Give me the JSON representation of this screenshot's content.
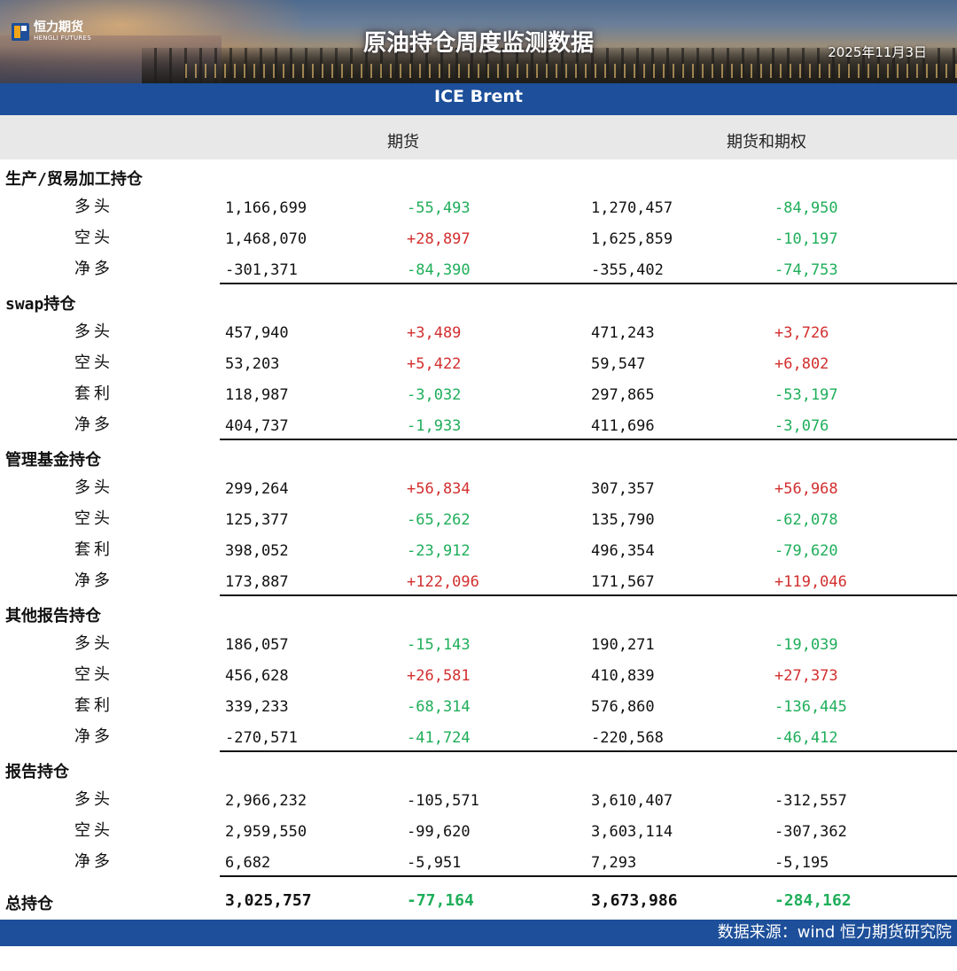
{
  "header": {
    "logo_cn": "恒力期货",
    "logo_en": "HENGLI FUTURES",
    "title": "原油持仓周度监测数据",
    "date": "2025年11月3日"
  },
  "subtitle": "ICE Brent",
  "columns": {
    "futures": "期货",
    "futures_options": "期货和期权"
  },
  "sections": [
    {
      "label": "生产/贸易加工持仓",
      "rows": [
        {
          "label": "多头",
          "v1": "1,166,699",
          "c1": "-55,493",
          "v2": "1,270,457",
          "c2": "-84,950",
          "s1": "neg",
          "s2": "neg"
        },
        {
          "label": "空头",
          "v1": "1,468,070",
          "c1": "+28,897",
          "v2": "1,625,859",
          "c2": "-10,197",
          "s1": "pos",
          "s2": "neg"
        },
        {
          "label": "净多",
          "v1": "-301,371",
          "c1": "-84,390",
          "v2": "-355,402",
          "c2": "-74,753",
          "s1": "neg",
          "s2": "neg"
        }
      ]
    },
    {
      "label": "swap持仓",
      "rows": [
        {
          "label": "多头",
          "v1": "457,940",
          "c1": "+3,489",
          "v2": "471,243",
          "c2": "+3,726",
          "s1": "pos",
          "s2": "pos"
        },
        {
          "label": "空头",
          "v1": "53,203",
          "c1": "+5,422",
          "v2": "59,547",
          "c2": "+6,802",
          "s1": "pos",
          "s2": "pos"
        },
        {
          "label": "套利",
          "v1": "118,987",
          "c1": "-3,032",
          "v2": "297,865",
          "c2": "-53,197",
          "s1": "neg",
          "s2": "neg"
        },
        {
          "label": "净多",
          "v1": "404,737",
          "c1": "-1,933",
          "v2": "411,696",
          "c2": "-3,076",
          "s1": "neg",
          "s2": "neg"
        }
      ]
    },
    {
      "label": "管理基金持仓",
      "rows": [
        {
          "label": "多头",
          "v1": "299,264",
          "c1": "+56,834",
          "v2": "307,357",
          "c2": "+56,968",
          "s1": "pos",
          "s2": "pos"
        },
        {
          "label": "空头",
          "v1": "125,377",
          "c1": "-65,262",
          "v2": "135,790",
          "c2": "-62,078",
          "s1": "neg",
          "s2": "neg"
        },
        {
          "label": "套利",
          "v1": "398,052",
          "c1": "-23,912",
          "v2": "496,354",
          "c2": "-79,620",
          "s1": "neg",
          "s2": "neg"
        },
        {
          "label": "净多",
          "v1": "173,887",
          "c1": "+122,096",
          "v2": "171,567",
          "c2": "+119,046",
          "s1": "pos",
          "s2": "pos"
        }
      ]
    },
    {
      "label": "其他报告持仓",
      "rows": [
        {
          "label": "多头",
          "v1": "186,057",
          "c1": "-15,143",
          "v2": "190,271",
          "c2": "-19,039",
          "s1": "neg",
          "s2": "neg"
        },
        {
          "label": "空头",
          "v1": "456,628",
          "c1": "+26,581",
          "v2": "410,839",
          "c2": "+27,373",
          "s1": "pos",
          "s2": "pos"
        },
        {
          "label": "套利",
          "v1": "339,233",
          "c1": "-68,314",
          "v2": "576,860",
          "c2": "-136,445",
          "s1": "neg",
          "s2": "neg"
        },
        {
          "label": "净多",
          "v1": "-270,571",
          "c1": "-41,724",
          "v2": "-220,568",
          "c2": "-46,412",
          "s1": "neg",
          "s2": "neg"
        }
      ]
    },
    {
      "label": "报告持仓",
      "rows": [
        {
          "label": "多头",
          "v1": "2,966,232",
          "c1": "-105,571",
          "v2": "3,610,407",
          "c2": "-312,557",
          "s1": "plain",
          "s2": "plain"
        },
        {
          "label": "空头",
          "v1": "2,959,550",
          "c1": "-99,620",
          "v2": "3,603,114",
          "c2": "-307,362",
          "s1": "plain",
          "s2": "plain"
        },
        {
          "label": "净多",
          "v1": "6,682",
          "c1": "-5,951",
          "v2": "7,293",
          "c2": "-5,195",
          "s1": "plain",
          "s2": "plain"
        }
      ]
    }
  ],
  "total": {
    "label": "总持仓",
    "v1": "3,025,757",
    "c1": "-77,164",
    "v2": "3,673,986",
    "c2": "-284,162",
    "s1": "neg",
    "s2": "neg"
  },
  "footer": "数据来源：wind  恒力期货研究院",
  "colors": {
    "brand_blue": "#1d4f9a",
    "increase": "#d32f2f",
    "decrease": "#1fae5a",
    "header_gray": "#e8e8e8"
  }
}
